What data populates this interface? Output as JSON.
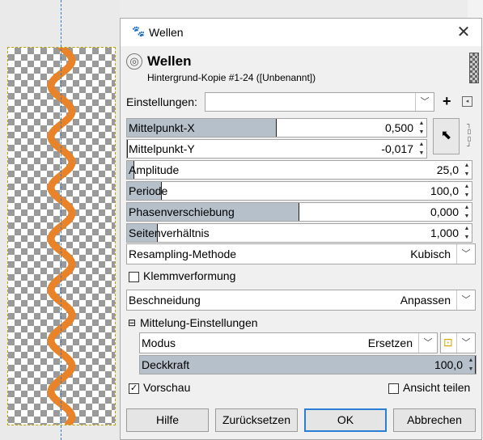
{
  "dialog": {
    "window_title": "Wellen",
    "close_glyph": "✕",
    "header_title": "Wellen",
    "header_subtitle": "Hintergrund-Kopie #1-24 ([Unbenannt])",
    "settings_label": "Einstellungen:",
    "settings_value": "",
    "add_glyph": "+",
    "menu_glyph": "◂",
    "sliders": [
      {
        "label": "Mittelpunkt-X",
        "value": "0,500",
        "fill": 0.5
      },
      {
        "label": "Mittelpunkt-Y",
        "value": "-0,017",
        "fill": 0.0
      },
      {
        "label": "Amplitude",
        "value": "25,0",
        "fill": 0.02
      },
      {
        "label": "Periode",
        "value": "100,0",
        "fill": 0.1
      },
      {
        "label": "Phasenverschiebung",
        "value": "0,000",
        "fill": 0.5
      },
      {
        "label": "Seitenverhältnis",
        "value": "1,000",
        "fill": 0.09
      }
    ],
    "resampling": {
      "label": "Resampling-Methode",
      "value": "Kubisch"
    },
    "clamp_label": "Klemmverformung",
    "clamp_checked": false,
    "clipping": {
      "label": "Beschneidung",
      "value": "Anpassen"
    },
    "blend_section": {
      "label": "Mittelung-Einstellungen",
      "toggle": "⊟"
    },
    "mode": {
      "label": "Modus",
      "value": "Ersetzen"
    },
    "opacity": {
      "label": "Deckkraft",
      "value": "100,0",
      "fill": 1.0
    },
    "preview_label": "Vorschau",
    "preview_checked": true,
    "split_view_label": "Ansicht teilen",
    "split_view_checked": false,
    "buttons": {
      "help": "Hilfe",
      "reset": "Zurücksetzen",
      "ok": "OK",
      "cancel": "Abbrechen"
    }
  },
  "icons": {
    "app": "gimp-wilber-icon",
    "filter": "wave-filter-icon",
    "picker": "pointer-picker-icon",
    "chain": "chain-link-icon",
    "mode_switch": "mode-switch-icon"
  },
  "colors": {
    "slider_fill": "#b5c0cb",
    "wave": "#e8832a",
    "ok_border": "#2a7fd4",
    "guide": "#2a7fd4"
  }
}
